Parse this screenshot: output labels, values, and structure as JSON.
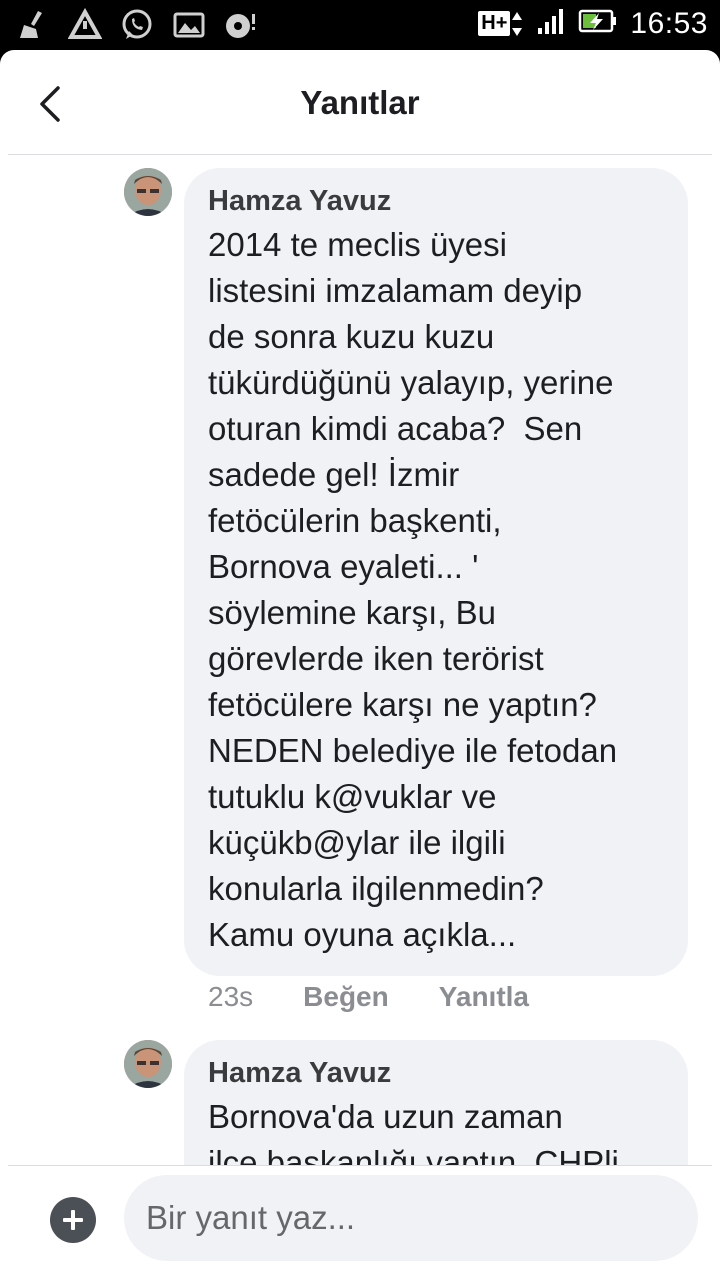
{
  "status_bar": {
    "time": "16:53",
    "network": "H+",
    "left_icons": [
      "broom-icon",
      "warning-icon",
      "whatsapp-icon",
      "image-icon",
      "media-icon"
    ],
    "right_icons": [
      "network-h-plus-icon",
      "signal-icon",
      "battery-charging-icon"
    ]
  },
  "header": {
    "title": "Yanıtlar",
    "back_icon": "chevron-left-icon"
  },
  "comments": [
    {
      "author": "Hamza Yavuz",
      "text": "2014 te meclis üyesi\nlistesini imzalamam deyip\nde sonra kuzu kuzu\ntükürdüğünü yalayıp, yerine\noturan kimdi acaba?  Sen\nsadede gel! İzmir\nfetöcülerin başkenti,\nBornova eyaleti... '\nsöylemine karşı, Bu\ngörevlerde iken terörist\nfetöcülere karşı ne yaptın?\nNEDEN belediye ile fetodan\ntutuklu k@vuklar ve\nküçükb@ylar ile ilgili\nkonularla ilgilenmedin?\nKamu oyuna açıkla...",
      "time": "23s",
      "like": "Beğen",
      "reply": "Yanıtla"
    },
    {
      "author": "Hamza Yavuz",
      "text": "Bornova'da uzun zaman\nilçe başkanlığı yaptın, CHPli"
    }
  ],
  "composer": {
    "placeholder": "Bir yanıt yaz...",
    "add_icon": "plus-circle-icon"
  },
  "colors": {
    "bubble": "#f0f2f5",
    "secondary_text": "#8a8d91",
    "header_text": "#1c1e21"
  }
}
